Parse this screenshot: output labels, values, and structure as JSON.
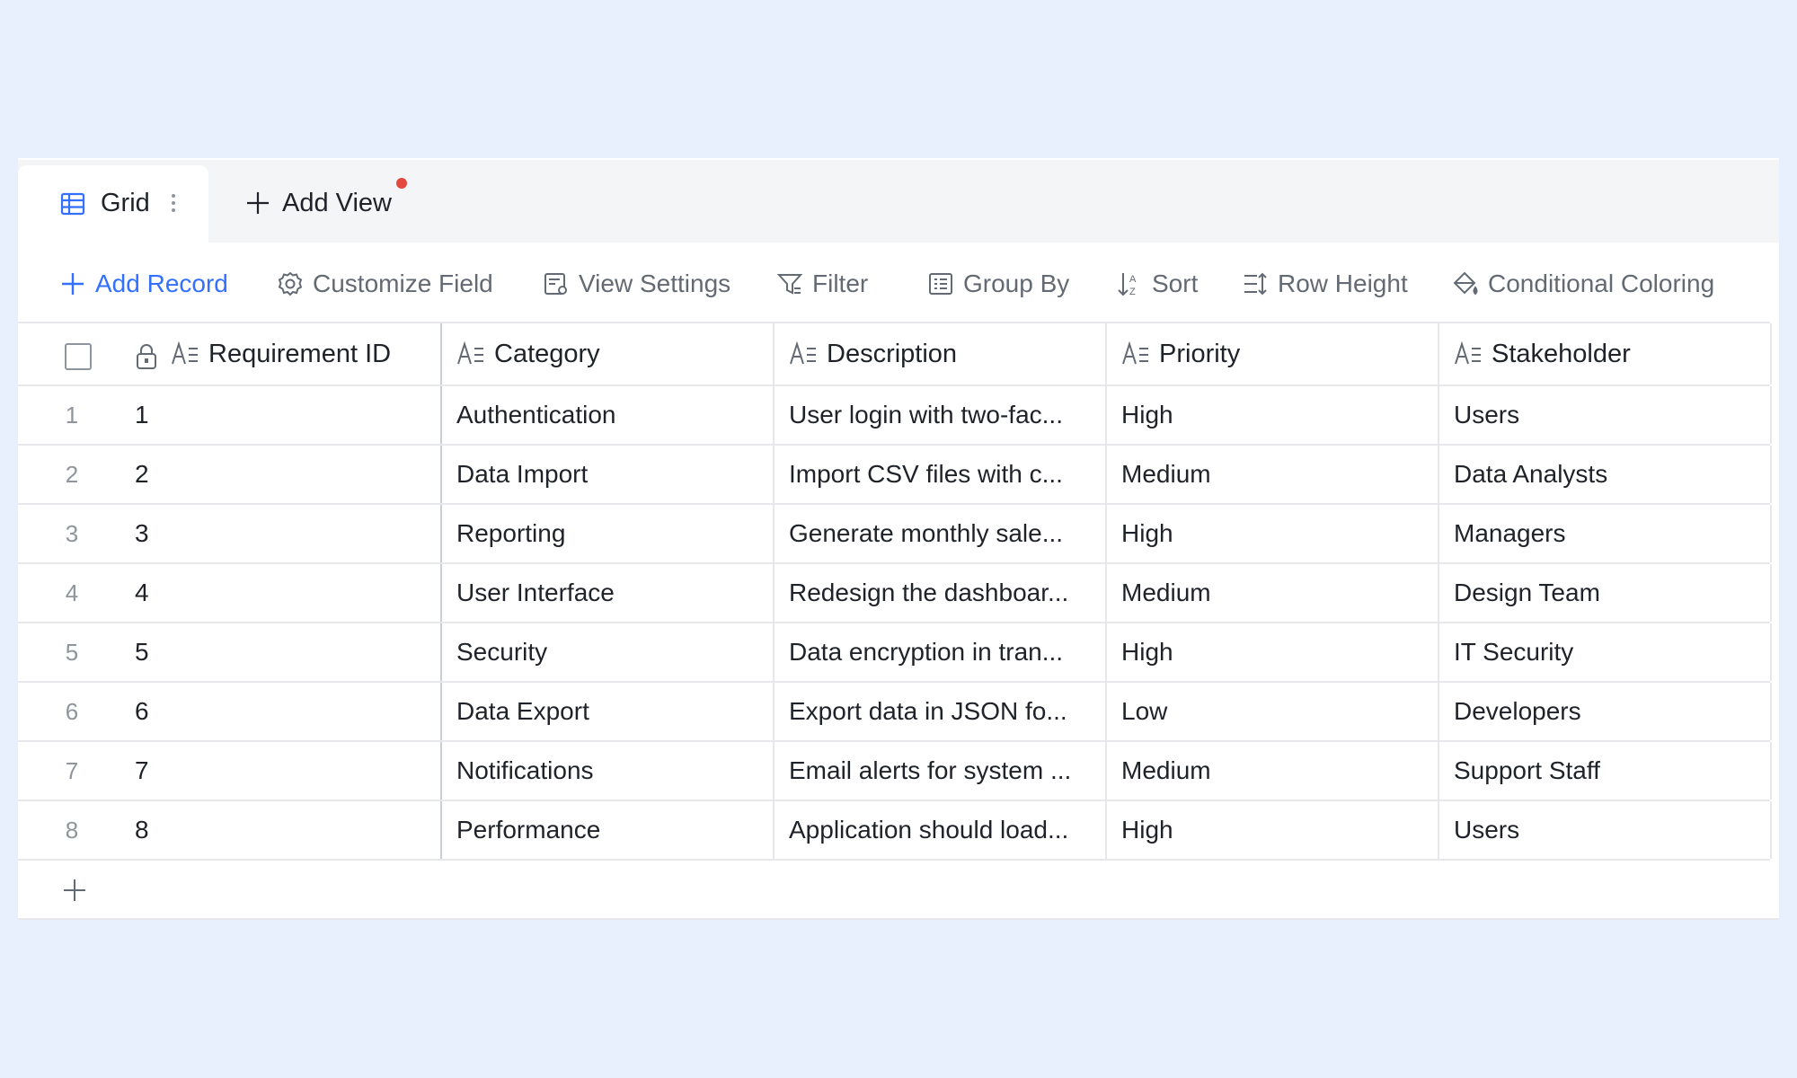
{
  "tabs": {
    "active_label": "Grid",
    "add_view_label": "Add View"
  },
  "toolbar": {
    "add_record": "Add Record",
    "customize_field": "Customize Field",
    "view_settings": "View Settings",
    "filter": "Filter",
    "group_by": "Group By",
    "sort": "Sort",
    "row_height": "Row Height",
    "conditional_coloring": "Conditional Coloring"
  },
  "columns": [
    "Requirement ID",
    "Category",
    "Description",
    "Priority",
    "Stakeholder"
  ],
  "rows": [
    {
      "index": "1",
      "cells": [
        "1",
        "Authentication",
        "User login with two-fac...",
        "High",
        "Users"
      ]
    },
    {
      "index": "2",
      "cells": [
        "2",
        "Data Import",
        "Import CSV files with c...",
        "Medium",
        "Data Analysts"
      ]
    },
    {
      "index": "3",
      "cells": [
        "3",
        "Reporting",
        "Generate monthly sale...",
        "High",
        "Managers"
      ]
    },
    {
      "index": "4",
      "cells": [
        "4",
        "User Interface",
        "Redesign the dashboar...",
        "Medium",
        "Design Team"
      ]
    },
    {
      "index": "5",
      "cells": [
        "5",
        "Security",
        "Data encryption in tran...",
        "High",
        "IT Security"
      ]
    },
    {
      "index": "6",
      "cells": [
        "6",
        "Data Export",
        "Export data in JSON fo...",
        "Low",
        "Developers"
      ]
    },
    {
      "index": "7",
      "cells": [
        "7",
        "Notifications",
        "Email alerts for system ...",
        "Medium",
        "Support Staff"
      ]
    },
    {
      "index": "8",
      "cells": [
        "8",
        "Performance",
        "Application should load...",
        "High",
        "Users"
      ]
    }
  ],
  "colors": {
    "accent": "#3370ff",
    "page_background": "#e9f0fd",
    "notification_dot": "#e5483e"
  }
}
